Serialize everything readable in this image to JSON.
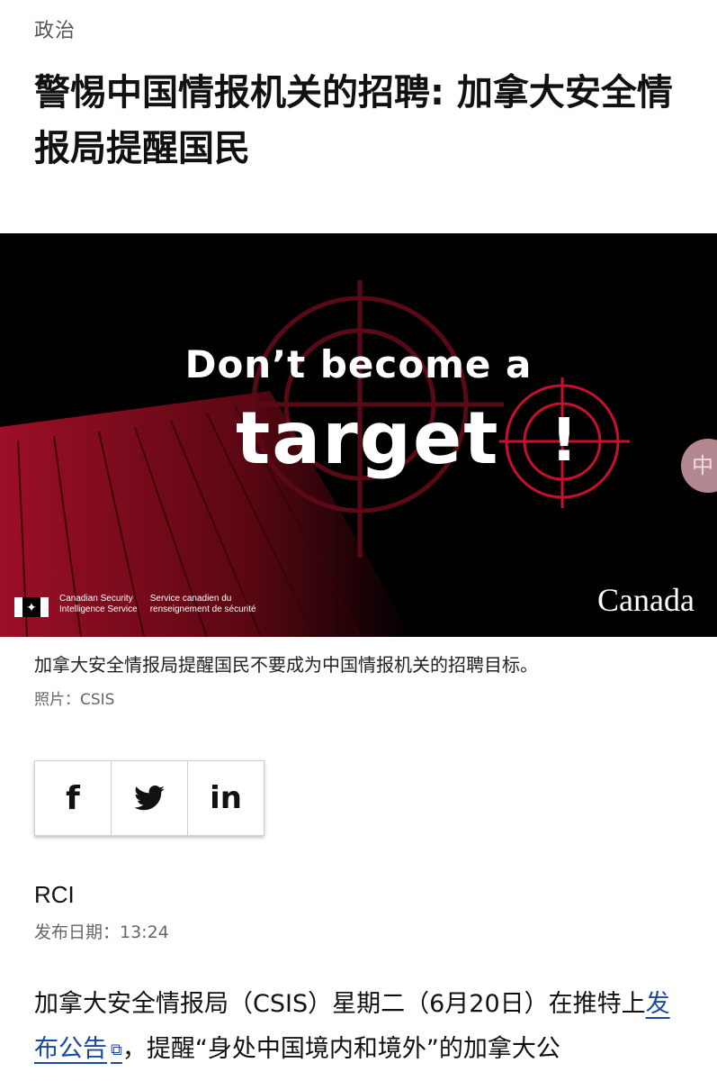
{
  "category": "政治",
  "headline": "警惕中国情报机关的招聘: 加拿大安全情报局提醒国民",
  "hero": {
    "line1": "Don’t become a",
    "line2": "target",
    "exclaim": "!",
    "csis_en_1": "Canadian Security",
    "csis_en_2": "Intelligence Service",
    "csis_fr_1": "Service canadien du",
    "csis_fr_2": "renseignement de sécurité",
    "canada_wordmark": "Canada",
    "maple_leaf": "✦"
  },
  "side_tab_text": "中",
  "caption": "加拿大安全情报局提醒国民不要成为中国情报机关的招聘目标。",
  "photo_credit": "照片：CSIS",
  "share": {
    "facebook_icon": "f",
    "twitter_icon": "twitter-bird",
    "linkedin_icon": "in"
  },
  "author": "RCI",
  "pubdate": "发布日期：13:24",
  "body": {
    "part1": "加拿大安全情报局（CSIS）星期二（6月20日）在推特上",
    "link": "发布公告",
    "part2": "，提醒“身处中国境内和境外”的加拿大公"
  },
  "colors": {
    "link": "#1a4a9e",
    "hero_red": "#b0122a"
  }
}
